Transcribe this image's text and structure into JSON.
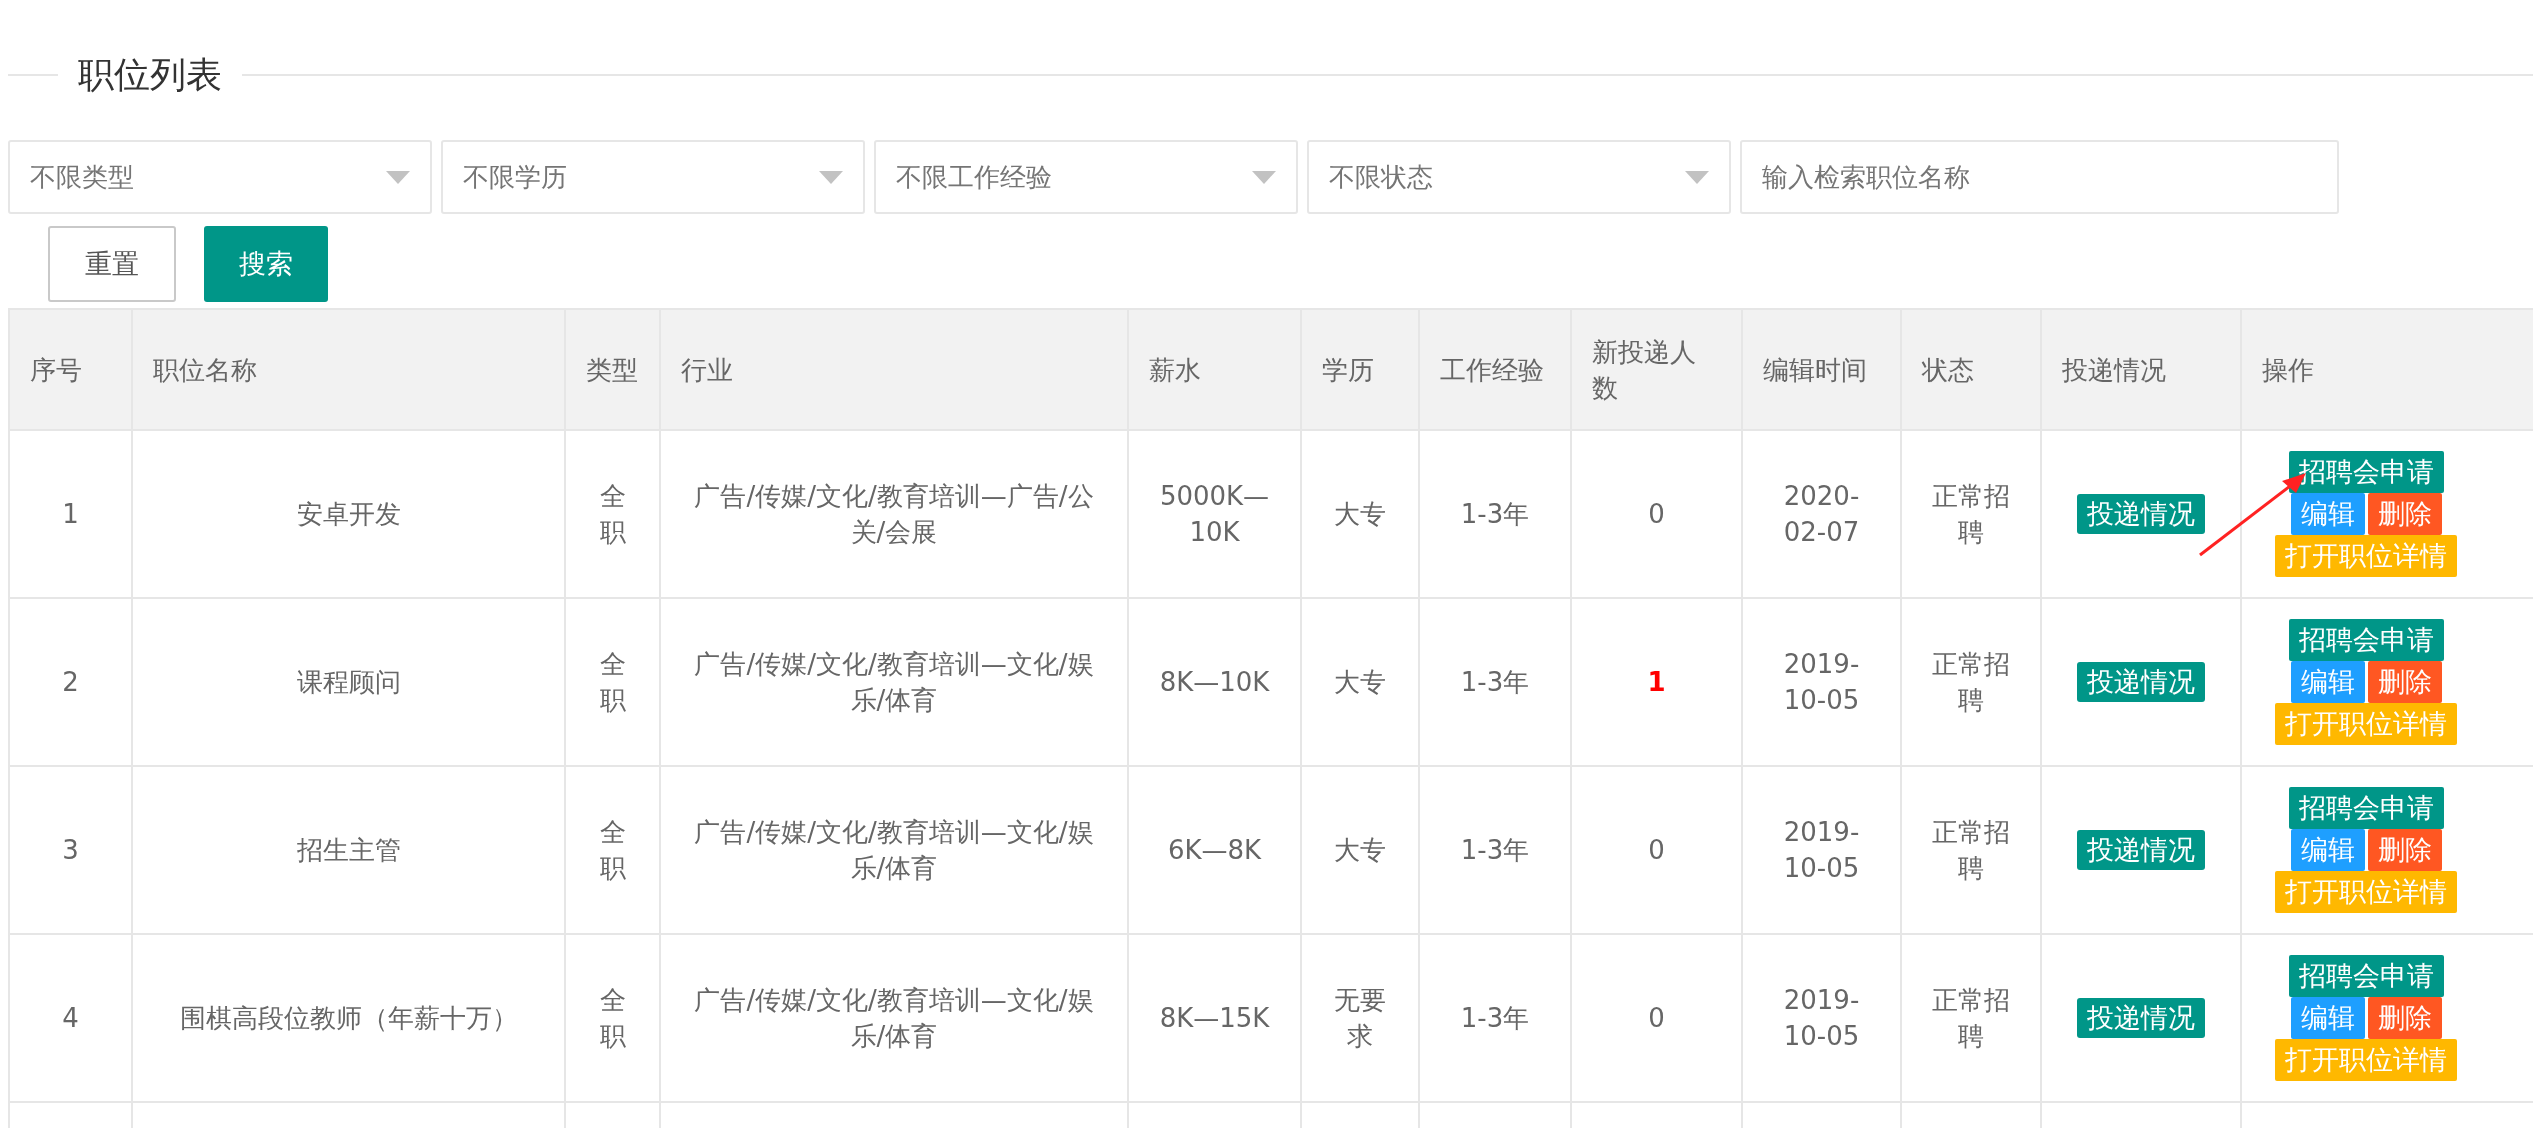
{
  "title": "职位列表",
  "filters": [
    {
      "kind": "select",
      "placeholder": "不限类型"
    },
    {
      "kind": "select",
      "placeholder": "不限学历"
    },
    {
      "kind": "select",
      "placeholder": "不限工作经验"
    },
    {
      "kind": "select",
      "placeholder": "不限状态"
    },
    {
      "kind": "input",
      "placeholder": "输入检索职位名称"
    }
  ],
  "buttons": [
    {
      "label": "重置",
      "kind": "plain"
    },
    {
      "label": "搜索",
      "kind": "primary"
    }
  ],
  "table": {
    "columns": [
      "序号",
      "职位名称",
      "类型",
      "行业",
      "薪水",
      "学历",
      "工作经验",
      "新投递人数",
      "编辑时间",
      "状态",
      "投递情况",
      "操作"
    ],
    "rows": [
      {
        "cells": [
          "1",
          "安卓开发",
          "全职",
          "广告/传媒/文化/教育培训—广告/公关/会展",
          "5000K—10K",
          "大专",
          "1-3年",
          "0",
          "2020-02-07",
          "正常招聘"
        ],
        "new_highlight": false,
        "delivery": "投递情况",
        "actions": [
          "招聘会申请",
          "编辑",
          "删除",
          "打开职位详情"
        ],
        "arrow_marked": true
      },
      {
        "cells": [
          "2",
          "课程顾问",
          "全职",
          "广告/传媒/文化/教育培训—文化/娱乐/体育",
          "8K—10K",
          "大专",
          "1-3年",
          "1",
          "2019-10-05",
          "正常招聘"
        ],
        "new_highlight": true,
        "delivery": "投递情况",
        "actions": [
          "招聘会申请",
          "编辑",
          "删除",
          "打开职位详情"
        ],
        "arrow_marked": false
      },
      {
        "cells": [
          "3",
          "招生主管",
          "全职",
          "广告/传媒/文化/教育培训—文化/娱乐/体育",
          "6K—8K",
          "大专",
          "1-3年",
          "0",
          "2019-10-05",
          "正常招聘"
        ],
        "new_highlight": false,
        "delivery": "投递情况",
        "actions": [
          "招聘会申请",
          "编辑",
          "删除",
          "打开职位详情"
        ],
        "arrow_marked": false
      },
      {
        "cells": [
          "4",
          "围棋高段位教师（年薪十万）",
          "全职",
          "广告/传媒/文化/教育培训—文化/娱乐/体育",
          "8K—15K",
          "无要求",
          "1-3年",
          "0",
          "2019-10-05",
          "正常招聘"
        ],
        "new_highlight": false,
        "delivery": "投递情况",
        "actions": [
          "招聘会申请",
          "编辑",
          "删除",
          "打开职位详情"
        ],
        "arrow_marked": false
      }
    ]
  }
}
